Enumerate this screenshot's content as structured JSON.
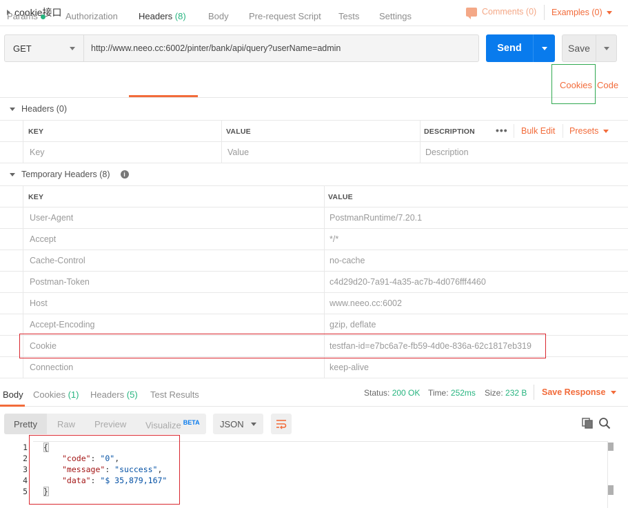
{
  "request": {
    "name": "cookie接口",
    "comments_label": "Comments (0)",
    "examples_label": "Examples (0)",
    "method": "GET",
    "url": "http://www.neeo.cc:6002/pinter/bank/api/query?userName=admin",
    "send_label": "Send",
    "save_label": "Save"
  },
  "req_tabs": {
    "params": "Params",
    "authorization": "Authorization",
    "headers": "Headers",
    "headers_count": "(8)",
    "body": "Body",
    "prerequest": "Pre-request Script",
    "tests": "Tests",
    "settings": "Settings",
    "cookies": "Cookies",
    "code": "Code"
  },
  "headers_section": {
    "title": "Headers (0)",
    "col_key": "KEY",
    "col_value": "VALUE",
    "col_description": "DESCRIPTION",
    "more": "•••",
    "bulk_edit": "Bulk Edit",
    "presets": "Presets",
    "key_placeholder": "Key",
    "value_placeholder": "Value",
    "description_placeholder": "Description"
  },
  "temp_headers": {
    "title": "Temporary Headers (8)",
    "info": "i",
    "col_key": "KEY",
    "col_value": "VALUE",
    "rows": [
      {
        "key": "User-Agent",
        "value": "PostmanRuntime/7.20.1"
      },
      {
        "key": "Accept",
        "value": "*/*"
      },
      {
        "key": "Cache-Control",
        "value": "no-cache"
      },
      {
        "key": "Postman-Token",
        "value": "c4d29d20-7a91-4a35-ac7b-4d076fff4460"
      },
      {
        "key": "Host",
        "value": "www.neeo.cc:6002"
      },
      {
        "key": "Accept-Encoding",
        "value": "gzip, deflate"
      },
      {
        "key": "Cookie",
        "value": "testfan-id=e7bc6a7e-fb59-4d0e-836a-62c1817eb319"
      },
      {
        "key": "Connection",
        "value": "keep-alive"
      }
    ]
  },
  "response": {
    "tab_body": "Body",
    "tab_cookies": "Cookies",
    "tab_cookies_count": "(1)",
    "tab_headers": "Headers",
    "tab_headers_count": "(5)",
    "tab_test_results": "Test Results",
    "status_label": "Status:",
    "status_value": "200 OK",
    "time_label": "Time:",
    "time_value": "252ms",
    "size_label": "Size:",
    "size_value": "232 B",
    "save_response": "Save Response"
  },
  "body_toolbar": {
    "pretty": "Pretty",
    "raw": "Raw",
    "preview": "Preview",
    "visualize": "Visualize",
    "beta": "BETA",
    "language": "JSON"
  },
  "code_lines": {
    "ln1": "1",
    "ln2": "2",
    "ln3": "3",
    "ln4": "4",
    "ln5": "5",
    "open": "{",
    "k1": "\"code\"",
    "v1": "\"0\"",
    "k2": "\"message\"",
    "v2": "\"success\"",
    "k3": "\"data\"",
    "v3": "\"$ 35,879,167\"",
    "close": "}"
  },
  "colors": {
    "accent": "#f26b3a",
    "send": "#097bed",
    "success": "#26b47f",
    "highlight_red": "#d9262e",
    "highlight_green": "#2fa84f"
  }
}
